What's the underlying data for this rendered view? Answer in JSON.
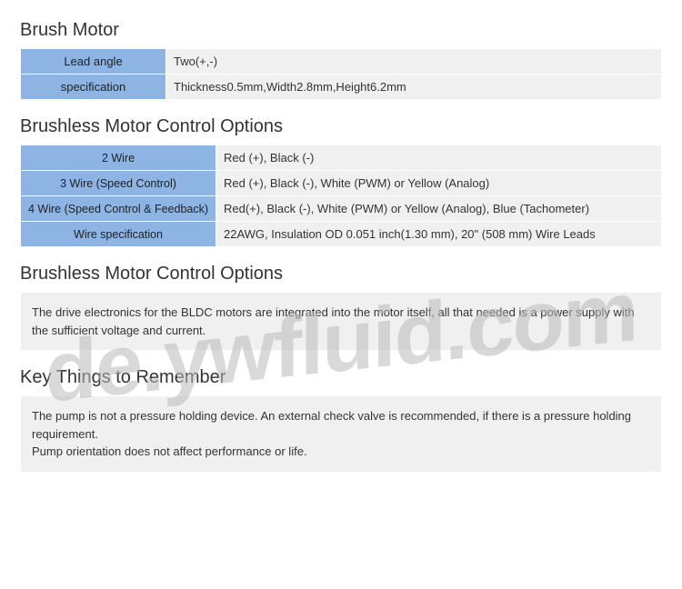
{
  "section1": {
    "title": "Brush Motor",
    "rows": [
      {
        "label": "Lead angle",
        "value": "Two(+,-)"
      },
      {
        "label": "specification",
        "value": "Thickness0.5mm,Width2.8mm,Height6.2mm"
      }
    ]
  },
  "section2": {
    "title": "Brushless Motor Control Options",
    "rows": [
      {
        "label": "2 Wire",
        "value": "Red (+), Black (-)"
      },
      {
        "label": "3 Wire (Speed Control)",
        "value": "Red (+), Black (-), White (PWM) or Yellow (Analog)"
      },
      {
        "label": "4 Wire (Speed Control & Feedback)",
        "value": "Red(+), Black (-), White (PWM) or Yellow (Analog), Blue (Tachometer)"
      },
      {
        "label": "Wire specification",
        "value": "22AWG, Insulation OD 0.051 inch(1.30 mm), 20\" (508 mm) Wire Leads"
      }
    ]
  },
  "section3": {
    "title": "Brushless Motor Control Options",
    "text": "The drive electronics for the BLDC motors are integrated into the motor itself, all that needed is a power supply with the sufficient voltage and current."
  },
  "section4": {
    "title": "Key Things to Remember",
    "line1": "The pump is not a pressure holding device. An external check valve is recommended, if there is a pressure holding requirement.",
    "line2": "Pump orientation does not affect performance or life."
  },
  "watermark": "de.ywfluid.com"
}
